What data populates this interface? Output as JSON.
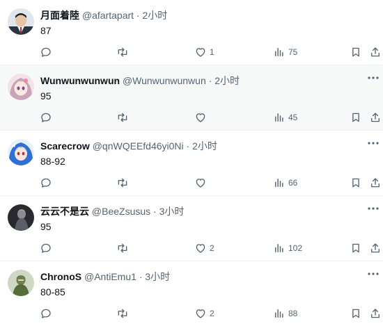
{
  "tweets": [
    {
      "name": "月面着陸",
      "handle": "@afartapart",
      "dot": "·",
      "time": "2小时",
      "text": "87",
      "likes": "1",
      "views": "75",
      "avatar": "avatar-man-in-suit"
    },
    {
      "name": "Wunwunwunwun",
      "handle": "@Wunwunwunwun",
      "dot": "·",
      "time": "2小时",
      "text": "95",
      "likes": "",
      "views": "45",
      "avatar": "avatar-anime-girl-pink-hair"
    },
    {
      "name": "Scarecrow",
      "handle": "@qnWQEEfd46yi0Ni",
      "dot": "·",
      "time": "2小时",
      "text": "88-92",
      "likes": "",
      "views": "66",
      "avatar": "avatar-anime-blue-hair"
    },
    {
      "name": "云云不是云",
      "handle": "@BeeZsusus",
      "dot": "·",
      "time": "3小时",
      "text": "95",
      "likes": "2",
      "views": "102",
      "avatar": "avatar-dark-figure"
    },
    {
      "name": "ChronoS",
      "handle": "@AntiEmu1",
      "dot": "·",
      "time": "3小时",
      "text": "80-85",
      "likes": "2",
      "views": "88",
      "avatar": "avatar-green-figure"
    }
  ],
  "icons": {
    "reply": "reply-icon",
    "retweet": "retweet-icon",
    "like": "heart-icon",
    "views": "views-icon",
    "bookmark": "bookmark-icon",
    "share": "share-icon",
    "more": "more-icon"
  },
  "colors": {
    "text": "#0f1419",
    "secondary": "#536471",
    "alt_background": "#f7f9f9",
    "divider": "#eff3f4"
  }
}
